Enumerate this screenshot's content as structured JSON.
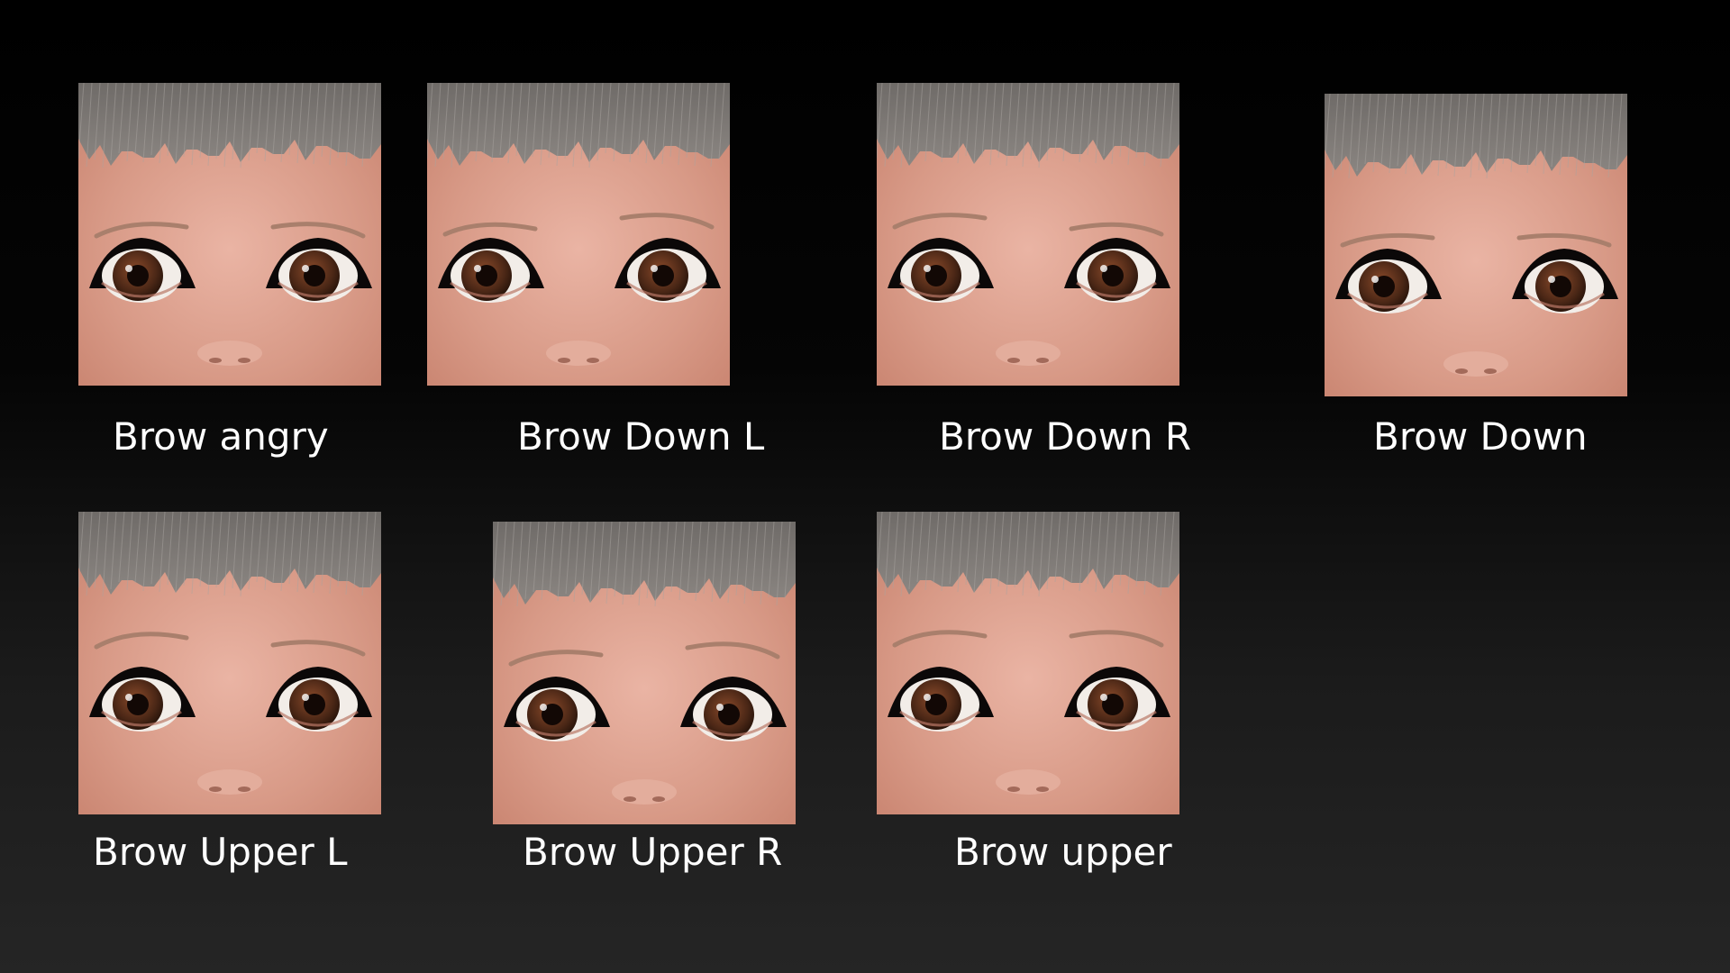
{
  "colors": {
    "skin_light": "#eab4a4",
    "skin_mid": "#d89a87",
    "skin_dark": "#c98470",
    "hair": "#8b8682",
    "iris": "#4b2716",
    "sclera": "#f2ede8",
    "eyelid": "#0b0808",
    "label_text": "#ffffff"
  },
  "tiles": [
    {
      "label": "Brow angry",
      "brow_shape": "angry"
    },
    {
      "label": "Brow Down L",
      "brow_shape": "down-left"
    },
    {
      "label": "Brow Down R",
      "brow_shape": "down-right"
    },
    {
      "label": "Brow Down",
      "brow_shape": "down"
    },
    {
      "label": "Brow Upper L",
      "brow_shape": "upper-left"
    },
    {
      "label": "Brow Upper R",
      "brow_shape": "upper-right"
    },
    {
      "label": "Brow upper",
      "brow_shape": "upper"
    }
  ]
}
